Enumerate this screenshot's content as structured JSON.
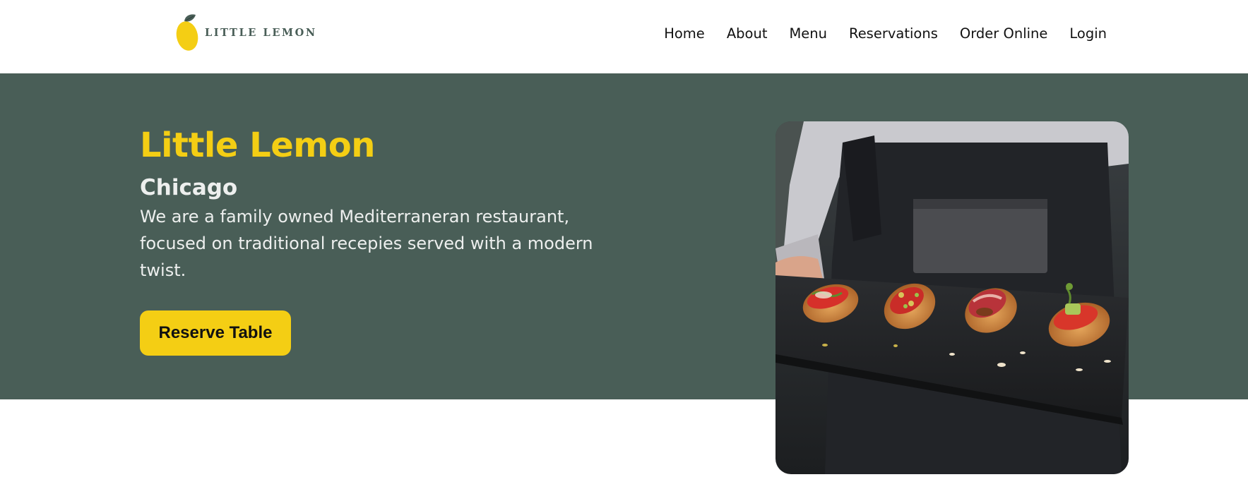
{
  "header": {
    "logo": {
      "text": "LITTLE LEMON",
      "icon": "lemon-icon",
      "colors": {
        "lemon": "#f4ce14",
        "leaf": "#495e57"
      }
    },
    "nav": [
      "Home",
      "About",
      "Menu",
      "Reservations",
      "Order Online",
      "Login"
    ]
  },
  "hero": {
    "title": "Little Lemon",
    "subtitle": "Chicago",
    "description": "We are a family owned Mediterraneran restaurant, focused on traditional recepies served with a modern twist.",
    "cta_label": "Reserve Table",
    "image": "bruschetta-food-photo"
  },
  "theme": {
    "primary_green": "#495e57",
    "primary_yellow": "#f4ce14",
    "light_text": "#edefee",
    "dark_text": "#111111"
  }
}
